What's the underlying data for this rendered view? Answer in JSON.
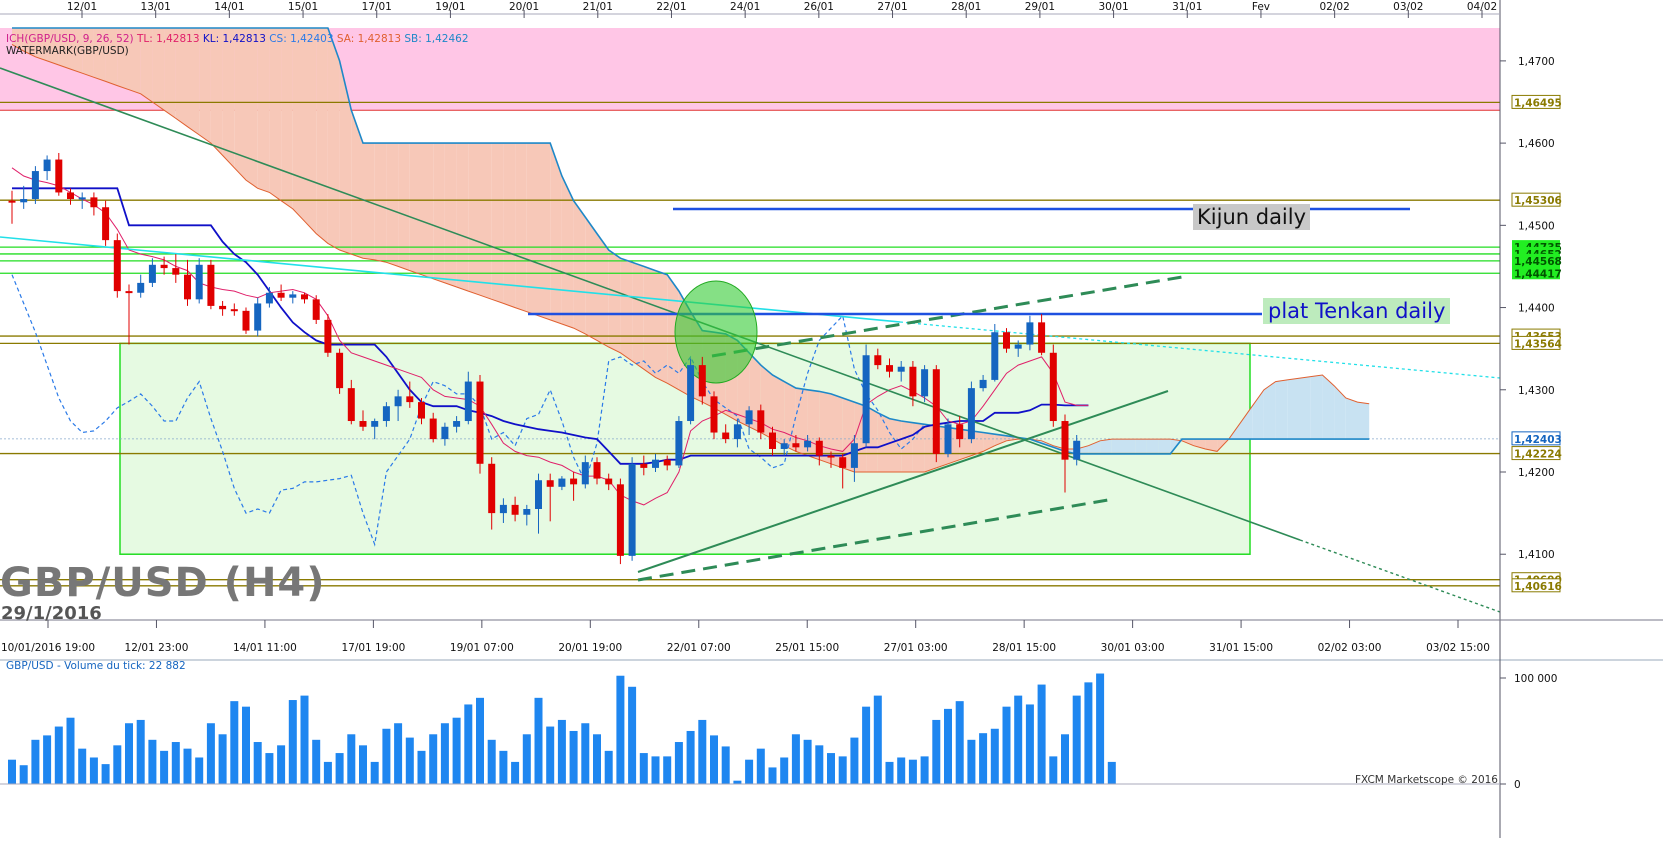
{
  "colors": {
    "bull": "#1565c0",
    "bear": "#e00000",
    "tenkan": "#e0206a",
    "kijun": "#1010c8",
    "senkou_b": "#1e88c8",
    "chikou": "#2a7ae8",
    "cloud_bear": "#f7c8b8",
    "cloud_bull": "#c8e2f2",
    "resistance_zone": "#ffc6e6",
    "range_box": "#e6fae2",
    "level_olive": "#8a7a00",
    "level_green": "#22dd22",
    "volume": "#1e86f0"
  },
  "header": {
    "indicator": "ICH(GBP/USD, 9, 26, 52)",
    "tl": "TL: 1,42813",
    "kl": "KL: 1,42813",
    "cs": "CS: 1,42403",
    "sa": "SA: 1,42813",
    "sb": "SB: 1,42462",
    "watermark": "WATERMARK(GBP/USD)"
  },
  "watermark": {
    "pair": "GBP/USD (H4)",
    "date": "29/1/2016"
  },
  "annotations": {
    "kijun": "Kijun daily",
    "tenkan": "plat Tenkan daily"
  },
  "volume_title": "GBP/USD - Volume du tick: 22 882",
  "copyright": "FXCM Marketscope © 2016",
  "chart_data": {
    "type": "candlestick",
    "top_axis_labels": [
      "12/01",
      "13/01",
      "14/01",
      "15/01",
      "17/01",
      "19/01",
      "20/01",
      "21/01",
      "22/01",
      "24/01",
      "26/01",
      "27/01",
      "28/01",
      "29/01",
      "30/01",
      "31/01",
      "Fev",
      "02/02",
      "03/02",
      "04/02"
    ],
    "bottom_axis_labels": [
      "10/01/2016 19:00",
      "12/01 23:00",
      "14/01 11:00",
      "17/01 19:00",
      "19/01 07:00",
      "20/01 19:00",
      "22/01 07:00",
      "25/01 15:00",
      "27/01 03:00",
      "28/01 15:00",
      "30/01 03:00",
      "31/01 15:00",
      "02/02 03:00",
      "03/02 15:00"
    ],
    "price_ticks": [
      "1,4700",
      "1,4600",
      "1,4500",
      "1,4400",
      "1,4300",
      "1,4200",
      "1,4100"
    ],
    "price_range": [
      1.402,
      1.474
    ],
    "level_labels": [
      {
        "value": 1.46495,
        "text": "1,46495",
        "color": "#8a7a00"
      },
      {
        "value": 1.45306,
        "text": "1,45306",
        "color": "#8a7a00"
      },
      {
        "value": 1.44735,
        "text": "1,44735",
        "color": "#22dd22"
      },
      {
        "value": 1.44652,
        "text": "1,44652",
        "color": "#22dd22"
      },
      {
        "value": 1.44568,
        "text": "1,44568",
        "color": "#22dd22"
      },
      {
        "value": 1.44417,
        "text": "1,44417",
        "color": "#22dd22"
      },
      {
        "value": 1.43653,
        "text": "1,43653",
        "color": "#8a7a00"
      },
      {
        "value": 1.43564,
        "text": "1,43564",
        "color": "#8a7a00"
      },
      {
        "value": 1.42403,
        "text": "1,42403",
        "color": "#1565c0"
      },
      {
        "value": 1.42224,
        "text": "1,42224",
        "color": "#8a7a00"
      },
      {
        "value": 1.4069,
        "text": "1,40690",
        "color": "#8a7a00"
      },
      {
        "value": 1.40616,
        "text": "1,40616",
        "color": "#8a7a00"
      }
    ],
    "volume_ticks": [
      "100 000",
      "0"
    ],
    "volume_range": [
      0,
      105000
    ],
    "candles": [
      [
        1.453,
        1.4542,
        1.4502,
        1.4528
      ],
      [
        1.4528,
        1.4548,
        1.452,
        1.4532
      ],
      [
        1.4532,
        1.4572,
        1.4526,
        1.4566
      ],
      [
        1.4566,
        1.4585,
        1.4555,
        1.458
      ],
      [
        1.458,
        1.4588,
        1.4536,
        1.454
      ],
      [
        1.454,
        1.4545,
        1.4525,
        1.4532
      ],
      [
        1.4532,
        1.454,
        1.452,
        1.4534
      ],
      [
        1.4534,
        1.454,
        1.4512,
        1.4522
      ],
      [
        1.4522,
        1.453,
        1.4475,
        1.4482
      ],
      [
        1.4482,
        1.449,
        1.4412,
        1.442
      ],
      [
        1.442,
        1.4428,
        1.4355,
        1.4418
      ],
      [
        1.4418,
        1.444,
        1.4412,
        1.443
      ],
      [
        1.443,
        1.446,
        1.4425,
        1.4452
      ],
      [
        1.4452,
        1.4462,
        1.444,
        1.4448
      ],
      [
        1.4448,
        1.4465,
        1.443,
        1.444
      ],
      [
        1.444,
        1.4458,
        1.4402,
        1.441
      ],
      [
        1.441,
        1.446,
        1.4405,
        1.4452
      ],
      [
        1.4452,
        1.4458,
        1.4398,
        1.4402
      ],
      [
        1.4402,
        1.4408,
        1.439,
        1.4398
      ],
      [
        1.4398,
        1.4405,
        1.439,
        1.4396
      ],
      [
        1.4396,
        1.44,
        1.4368,
        1.4372
      ],
      [
        1.4372,
        1.4412,
        1.4365,
        1.4405
      ],
      [
        1.4405,
        1.4425,
        1.44,
        1.4418
      ],
      [
        1.4418,
        1.4428,
        1.4408,
        1.4412
      ],
      [
        1.4412,
        1.442,
        1.4405,
        1.4416
      ],
      [
        1.4416,
        1.4418,
        1.4405,
        1.441
      ],
      [
        1.441,
        1.4415,
        1.438,
        1.4385
      ],
      [
        1.4385,
        1.4392,
        1.434,
        1.4345
      ],
      [
        1.4345,
        1.435,
        1.4295,
        1.4302
      ],
      [
        1.4302,
        1.4312,
        1.4258,
        1.4262
      ],
      [
        1.4262,
        1.4275,
        1.425,
        1.4255
      ],
      [
        1.4255,
        1.4265,
        1.424,
        1.4262
      ],
      [
        1.4262,
        1.4285,
        1.4255,
        1.428
      ],
      [
        1.428,
        1.43,
        1.4262,
        1.4292
      ],
      [
        1.4292,
        1.431,
        1.4278,
        1.4285
      ],
      [
        1.4285,
        1.429,
        1.4258,
        1.4265
      ],
      [
        1.4265,
        1.4272,
        1.4236,
        1.424
      ],
      [
        1.424,
        1.426,
        1.4232,
        1.4255
      ],
      [
        1.4255,
        1.4268,
        1.4248,
        1.4262
      ],
      [
        1.4262,
        1.4322,
        1.4258,
        1.431
      ],
      [
        1.431,
        1.4318,
        1.4198,
        1.421
      ],
      [
        1.421,
        1.4218,
        1.413,
        1.415
      ],
      [
        1.415,
        1.4168,
        1.4138,
        1.416
      ],
      [
        1.416,
        1.417,
        1.414,
        1.4148
      ],
      [
        1.4148,
        1.416,
        1.4135,
        1.4155
      ],
      [
        1.4155,
        1.4198,
        1.4125,
        1.419
      ],
      [
        1.419,
        1.4198,
        1.414,
        1.4182
      ],
      [
        1.4182,
        1.4195,
        1.4178,
        1.4192
      ],
      [
        1.4192,
        1.42,
        1.4165,
        1.4185
      ],
      [
        1.4185,
        1.422,
        1.418,
        1.4212
      ],
      [
        1.4212,
        1.4218,
        1.4185,
        1.4192
      ],
      [
        1.4192,
        1.4198,
        1.4178,
        1.4185
      ],
      [
        1.4185,
        1.4192,
        1.4088,
        1.4098
      ],
      [
        1.4098,
        1.4218,
        1.4092,
        1.421
      ],
      [
        1.421,
        1.422,
        1.4196,
        1.4205
      ],
      [
        1.4205,
        1.4222,
        1.42,
        1.4215
      ],
      [
        1.4215,
        1.422,
        1.4202,
        1.4208
      ],
      [
        1.4208,
        1.4268,
        1.4205,
        1.4262
      ],
      [
        1.4262,
        1.4338,
        1.4258,
        1.433
      ],
      [
        1.433,
        1.434,
        1.4282,
        1.4292
      ],
      [
        1.4292,
        1.4298,
        1.424,
        1.4248
      ],
      [
        1.4248,
        1.4258,
        1.4235,
        1.424
      ],
      [
        1.424,
        1.4265,
        1.423,
        1.4258
      ],
      [
        1.4258,
        1.428,
        1.4245,
        1.4275
      ],
      [
        1.4275,
        1.4282,
        1.424,
        1.4248
      ],
      [
        1.4248,
        1.4255,
        1.422,
        1.4228
      ],
      [
        1.4228,
        1.424,
        1.422,
        1.4235
      ],
      [
        1.4235,
        1.4245,
        1.4225,
        1.423
      ],
      [
        1.423,
        1.4245,
        1.4225,
        1.4238
      ],
      [
        1.4238,
        1.4242,
        1.4208,
        1.422
      ],
      [
        1.422,
        1.4225,
        1.4205,
        1.4218
      ],
      [
        1.4218,
        1.4222,
        1.418,
        1.4205
      ],
      [
        1.4205,
        1.4245,
        1.4188,
        1.4235
      ],
      [
        1.4235,
        1.4355,
        1.423,
        1.4342
      ],
      [
        1.4342,
        1.435,
        1.4325,
        1.433
      ],
      [
        1.433,
        1.4338,
        1.4315,
        1.4322
      ],
      [
        1.4322,
        1.4335,
        1.431,
        1.4328
      ],
      [
        1.4328,
        1.4335,
        1.428,
        1.4292
      ],
      [
        1.4292,
        1.433,
        1.4285,
        1.4325
      ],
      [
        1.4325,
        1.433,
        1.4212,
        1.4222
      ],
      [
        1.4222,
        1.4265,
        1.4218,
        1.4258
      ],
      [
        1.4258,
        1.4268,
        1.423,
        1.424
      ],
      [
        1.424,
        1.431,
        1.4235,
        1.4302
      ],
      [
        1.4302,
        1.4318,
        1.4298,
        1.4312
      ],
      [
        1.4312,
        1.438,
        1.431,
        1.437
      ],
      [
        1.437,
        1.4375,
        1.4345,
        1.435
      ],
      [
        1.435,
        1.436,
        1.434,
        1.4355
      ],
      [
        1.4355,
        1.439,
        1.4348,
        1.4382
      ],
      [
        1.4382,
        1.4392,
        1.4342,
        1.4345
      ],
      [
        1.4345,
        1.4355,
        1.4255,
        1.4262
      ],
      [
        1.4262,
        1.427,
        1.4175,
        1.4215
      ],
      [
        1.4215,
        1.4245,
        1.4208,
        1.4238
      ]
    ],
    "volume": [
      22000,
      17000,
      40000,
      44000,
      52000,
      60000,
      32000,
      24000,
      18000,
      35000,
      55000,
      58000,
      40000,
      30000,
      38000,
      32000,
      24000,
      55000,
      45000,
      75000,
      70000,
      38000,
      28000,
      35000,
      76000,
      80000,
      40000,
      20000,
      28000,
      45000,
      35000,
      20000,
      50000,
      55000,
      42000,
      30000,
      45000,
      55000,
      60000,
      72000,
      78000,
      40000,
      30000,
      20000,
      45000,
      78000,
      52000,
      58000,
      48000,
      55000,
      45000,
      30000,
      98000,
      88000,
      28000,
      25000,
      25000,
      38000,
      48000,
      58000,
      44000,
      34000,
      3000,
      22000,
      32000,
      15000,
      24000,
      45000,
      40000,
      35000,
      28000,
      25000,
      42000,
      70000,
      80000,
      20000,
      24000,
      22000,
      25000,
      58000,
      68000,
      75000,
      40000,
      46000,
      50000,
      70000,
      80000,
      72000,
      90000,
      25000,
      45000,
      80000,
      92000,
      100000,
      20000
    ],
    "ichimoku": {
      "tenkan": [
        1.457,
        1.456,
        1.4555,
        1.4552,
        1.4548,
        1.454,
        1.4532,
        1.4525,
        1.4515,
        1.4495,
        1.447,
        1.4465,
        1.4462,
        1.4458,
        1.445,
        1.4445,
        1.443,
        1.4425,
        1.4422,
        1.442,
        1.4415,
        1.4412,
        1.4418,
        1.442,
        1.4422,
        1.4418,
        1.441,
        1.439,
        1.436,
        1.4345,
        1.434,
        1.4335,
        1.433,
        1.4325,
        1.432,
        1.4315,
        1.43,
        1.4292,
        1.429,
        1.4288,
        1.428,
        1.4258,
        1.4235,
        1.4225,
        1.422,
        1.4218,
        1.4212,
        1.4208,
        1.42,
        1.4195,
        1.4195,
        1.419,
        1.4172,
        1.4165,
        1.416,
        1.4168,
        1.4175,
        1.42,
        1.425,
        1.4262,
        1.4268,
        1.4275,
        1.427,
        1.4265,
        1.426,
        1.4252,
        1.4248,
        1.4242,
        1.4238,
        1.4232,
        1.4228,
        1.4225,
        1.424,
        1.4282,
        1.4292,
        1.43,
        1.4305,
        1.4298,
        1.429,
        1.428,
        1.4262,
        1.4258,
        1.4262,
        1.428,
        1.43,
        1.432,
        1.433,
        1.4335,
        1.434,
        1.432,
        1.4285,
        1.4281,
        1.4281
      ],
      "kijun": [
        1.4545,
        1.4545,
        1.4545,
        1.4545,
        1.4545,
        1.4545,
        1.4545,
        1.4545,
        1.4545,
        1.4545,
        1.45,
        1.45,
        1.45,
        1.45,
        1.45,
        1.45,
        1.45,
        1.45,
        1.448,
        1.4465,
        1.4455,
        1.444,
        1.442,
        1.44,
        1.4382,
        1.437,
        1.436,
        1.4355,
        1.4355,
        1.4355,
        1.4355,
        1.4355,
        1.434,
        1.432,
        1.43,
        1.4285,
        1.428,
        1.428,
        1.428,
        1.4275,
        1.4272,
        1.4268,
        1.4262,
        1.4258,
        1.4255,
        1.4252,
        1.425,
        1.4248,
        1.4245,
        1.4242,
        1.424,
        1.4225,
        1.421,
        1.421,
        1.421,
        1.4212,
        1.4215,
        1.4215,
        1.422,
        1.422,
        1.422,
        1.422,
        1.422,
        1.422,
        1.422,
        1.422,
        1.422,
        1.422,
        1.422,
        1.422,
        1.422,
        1.422,
        1.4225,
        1.423,
        1.423,
        1.4235,
        1.424,
        1.4245,
        1.4255,
        1.4258,
        1.426,
        1.4262,
        1.4262,
        1.4262,
        1.4272,
        1.4272,
        1.4272,
        1.4275,
        1.4282,
        1.4282,
        1.4281,
        1.4281,
        1.4281
      ],
      "senkou_a": [
        1.472,
        1.4712,
        1.4705,
        1.47,
        1.4695,
        1.469,
        1.4685,
        1.468,
        1.4675,
        1.467,
        1.4665,
        1.466,
        1.465,
        1.464,
        1.463,
        1.462,
        1.461,
        1.46,
        1.4585,
        1.457,
        1.4555,
        1.4545,
        1.454,
        1.453,
        1.452,
        1.4505,
        1.449,
        1.4478,
        1.447,
        1.4465,
        1.446,
        1.4458,
        1.4455,
        1.445,
        1.4445,
        1.444,
        1.4435,
        1.443,
        1.4425,
        1.442,
        1.4415,
        1.441,
        1.4405,
        1.44,
        1.4395,
        1.439,
        1.4385,
        1.438,
        1.4375,
        1.4368,
        1.436,
        1.4352,
        1.4345,
        1.4335,
        1.4325,
        1.4315,
        1.4308,
        1.43,
        1.4292,
        1.4285,
        1.4278,
        1.427,
        1.4262,
        1.4255,
        1.4248,
        1.424,
        1.4232,
        1.4225,
        1.422,
        1.4215,
        1.421,
        1.4205,
        1.42,
        1.42,
        1.42,
        1.42,
        1.42,
        1.42,
        1.42,
        1.4205,
        1.421,
        1.4215,
        1.422,
        1.4225,
        1.4232,
        1.4238,
        1.424,
        1.424,
        1.4238,
        1.4232,
        1.4228,
        1.4228,
        1.4232,
        1.4238,
        1.424,
        1.424,
        1.424,
        1.424,
        1.424,
        1.424,
        1.4238,
        1.4232,
        1.4228,
        1.4225,
        1.424,
        1.426,
        1.428,
        1.43,
        1.431,
        1.4312,
        1.4314,
        1.4316,
        1.4318,
        1.4305,
        1.429,
        1.4285,
        1.4283
      ],
      "senkou_b": [
        1.474,
        1.474,
        1.474,
        1.474,
        1.474,
        1.474,
        1.474,
        1.474,
        1.474,
        1.474,
        1.474,
        1.474,
        1.474,
        1.474,
        1.474,
        1.474,
        1.474,
        1.474,
        1.474,
        1.474,
        1.474,
        1.474,
        1.474,
        1.474,
        1.474,
        1.474,
        1.474,
        1.474,
        1.47,
        1.464,
        1.46,
        1.46,
        1.46,
        1.46,
        1.46,
        1.46,
        1.46,
        1.46,
        1.46,
        1.46,
        1.46,
        1.46,
        1.46,
        1.46,
        1.46,
        1.46,
        1.46,
        1.456,
        1.453,
        1.451,
        1.449,
        1.447,
        1.446,
        1.4455,
        1.445,
        1.4445,
        1.444,
        1.442,
        1.4395,
        1.4372,
        1.437,
        1.4368,
        1.436,
        1.4345,
        1.433,
        1.4318,
        1.431,
        1.4302,
        1.43,
        1.4298,
        1.4295,
        1.429,
        1.4285,
        1.428,
        1.4272,
        1.4265,
        1.4262,
        1.426,
        1.4258,
        1.4256,
        1.4254,
        1.4252,
        1.425,
        1.4248,
        1.4246,
        1.4244,
        1.4242,
        1.424,
        1.4235,
        1.423,
        1.4225,
        1.4222,
        1.4222,
        1.4222,
        1.4222,
        1.4222,
        1.4222,
        1.4222,
        1.4222,
        1.4222,
        1.424,
        1.424,
        1.424,
        1.424,
        1.424,
        1.424,
        1.424,
        1.424,
        1.424,
        1.424,
        1.424,
        1.424,
        1.424,
        1.424,
        1.424,
        1.424,
        1.424
      ],
      "chikou": [
        1.444,
        1.4405,
        1.437,
        1.433,
        1.429,
        1.4262,
        1.4248,
        1.425,
        1.4262,
        1.4278,
        1.4286,
        1.4295,
        1.428,
        1.4262,
        1.4262,
        1.429,
        1.431,
        1.4265,
        1.4225,
        1.418,
        1.415,
        1.4155,
        1.415,
        1.4178,
        1.418,
        1.4188,
        1.4188,
        1.419,
        1.4192,
        1.4196,
        1.415,
        1.4112,
        1.42,
        1.422,
        1.424,
        1.428,
        1.431,
        1.4305,
        1.4295,
        1.4295,
        1.428,
        1.424,
        1.4248,
        1.4232,
        1.4265,
        1.427,
        1.43,
        1.4262,
        1.4218,
        1.4188,
        1.4235,
        1.4335,
        1.434,
        1.433,
        1.4335,
        1.432,
        1.433,
        1.432,
        1.434,
        1.431,
        1.4288,
        1.4278,
        1.4268,
        1.4228,
        1.4218,
        1.4205,
        1.421,
        1.4268,
        1.432,
        1.436,
        1.4375,
        1.439,
        1.4325,
        1.4295,
        1.4275,
        1.4248,
        1.4228,
        1.424,
        1.4258
      ]
    }
  }
}
